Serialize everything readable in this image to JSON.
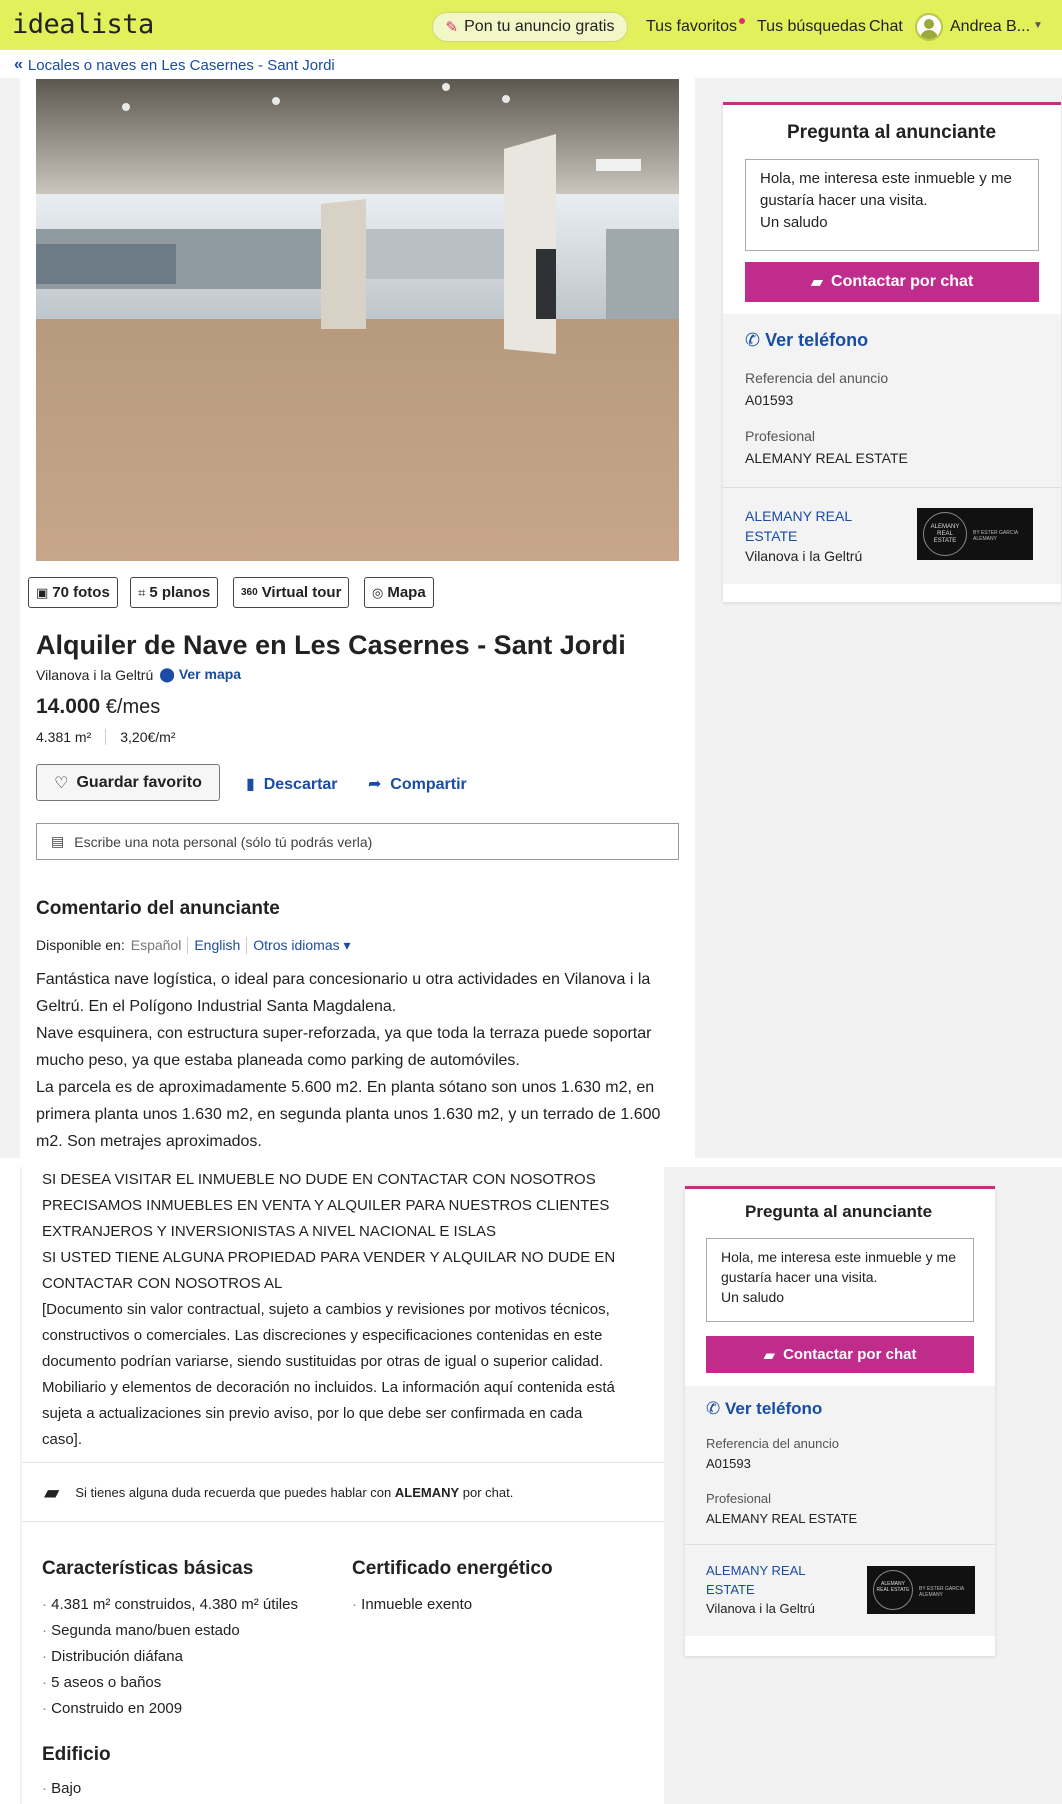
{
  "header": {
    "logo": "idealista",
    "publish": "Pon tu anuncio gratis",
    "favorites": "Tus favoritos",
    "searches": "Tus búsquedas",
    "chat": "Chat",
    "user": "Andrea B...",
    "accent": "#e1f05b"
  },
  "breadcrumb": "Locales o naves en Les Casernes - Sant Jordi",
  "media": {
    "photos": "70 fotos",
    "plans": "5 planos",
    "tour": "Virtual tour",
    "map": "Mapa"
  },
  "listing": {
    "title": "Alquiler de Nave en Les Casernes - Sant Jordi",
    "location": "Vilanova i la Geltrú",
    "map_link": "Ver mapa",
    "price": "14.000",
    "price_unit": "€/mes",
    "area": "4.381 m²",
    "price_m2": "3,20€/m²"
  },
  "actions": {
    "favorite": "Guardar favorito",
    "discard": "Descartar",
    "share": "Compartir",
    "note_placeholder": "Escribe una nota personal (sólo tú podrás verla)"
  },
  "comment": {
    "heading": "Comentario del anunciante",
    "available_in": "Disponible en:",
    "lang_current": "Español",
    "lang_english": "English",
    "lang_other": "Otros idiomas",
    "lines": [
      "Fantástica nave logística, o ideal para concesionario u otra actividades en Vilanova i la",
      "Geltrú. En el Polígono Industrial Santa Magdalena.",
      "Nave esquinera, con estructura super-reforzada, ya que toda la terraza puede soportar",
      "mucho peso, ya que estaba planeada como parking de automóviles.",
      "La parcela es de aproximadamente 5.600 m2. En planta sótano son unos 1.630 m2, en",
      "primera planta unos 1.630 m2, en segunda planta unos 1.630 m2, y un terrado de 1.600",
      "m2. Son metrajes aproximados."
    ],
    "lines2": [
      "SI DESEA VISITAR EL INMUEBLE NO DUDE EN CONTACTAR CON NOSOTROS",
      "PRECISAMOS INMUEBLES EN VENTA Y ALQUILER PARA NUESTROS CLIENTES",
      "EXTRANJEROS Y INVERSIONISTAS A NIVEL NACIONAL E ISLAS",
      "SI USTED TIENE ALGUNA PROPIEDAD PARA VENDER Y ALQUILAR NO DUDE EN",
      "CONTACTAR CON NOSOTROS AL",
      "[Documento sin valor contractual, sujeto a cambios y revisiones por motivos técnicos,",
      "constructivos o comerciales. Las discreciones y especificaciones contenidas en este",
      "documento podrían variarse, siendo sustituidas por otras de igual o superior calidad.",
      "Mobiliario y elementos de decoración no incluidos. La información aquí contenida está",
      "sujeta a actualizaciones sin previo aviso, por lo que debe ser confirmada en cada",
      "caso]."
    ]
  },
  "chat_note": {
    "prefix": "Si tienes alguna duda recuerda que puedes hablar con",
    "name": "ALEMANY",
    "suffix": "por chat."
  },
  "features": {
    "basic_heading": "Características básicas",
    "basic": [
      "4.381 m² construidos, 4.380 m² útiles",
      "Segunda mano/buen estado",
      "Distribución diáfana",
      "5 aseos o baños",
      "Construido en 2009"
    ],
    "energy_heading": "Certificado energético",
    "energy": [
      "Inmueble exento"
    ],
    "building_heading": "Edificio",
    "building": [
      "Bajo"
    ]
  },
  "contact": {
    "heading": "Pregunta al anunciante",
    "message_lines": [
      "Hola, me interesa este inmueble y me",
      "gustaría hacer una visita.",
      "Un saludo"
    ],
    "chat_button": "Contactar por chat",
    "phone": "Ver teléfono",
    "ref_label": "Referencia del anuncio",
    "ref_value": "A01593",
    "pro_label": "Profesional",
    "pro_value": "ALEMANY REAL ESTATE",
    "agency_line1": "ALEMANY REAL",
    "agency_line2": "ESTATE",
    "agency_city": "Vilanova i la Geltrú",
    "logo_text": "ALEMANY REAL ESTATE",
    "logo_sub": "BY ESTER GARCIA ALEMANY",
    "accent": "#c02c8c"
  }
}
